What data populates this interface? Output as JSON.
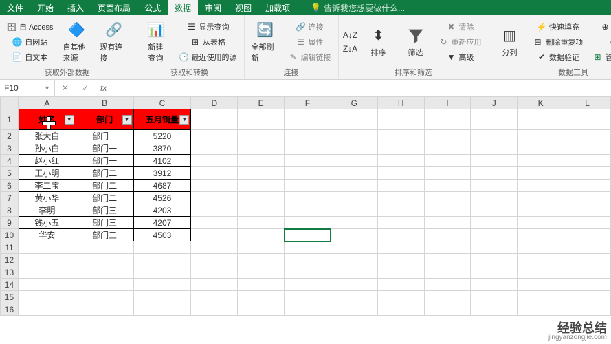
{
  "menu": {
    "tabs": [
      "文件",
      "开始",
      "插入",
      "页面布局",
      "公式",
      "数据",
      "审阅",
      "视图",
      "加载项"
    ],
    "active": 5,
    "tell_me": "告诉我您想要做什么..."
  },
  "ribbon": {
    "groups": {
      "external": {
        "label": "获取外部数据",
        "access": "自 Access",
        "web": "自网站",
        "text": "自文本",
        "other": "自其他来源",
        "existing": "现有连接"
      },
      "transform": {
        "label": "获取和转换",
        "newquery": "新建\n查询",
        "showquery": "显示查询",
        "fromtable": "从表格",
        "recent": "最近使用的源"
      },
      "connections": {
        "label": "连接",
        "refresh": "全部刷新",
        "conn": "连接",
        "prop": "属性",
        "edit": "编辑链接"
      },
      "sortfilter": {
        "label": "排序和筛选",
        "sortaz": "A↓Z",
        "sortza": "Z↓A",
        "sort": "排序",
        "filter": "筛选",
        "clear": "清除",
        "reapply": "重新应用",
        "advanced": "高级"
      },
      "datatools": {
        "label": "数据工具",
        "texttocol": "分列",
        "flashfill": "快速填充",
        "removedup": "删除重复项",
        "validation": "数据验证",
        "consolidate": "合并计算",
        "relations": "关系",
        "datamodel": "管理数据模型"
      }
    }
  },
  "namebox": "F10",
  "formula": "",
  "columns": [
    "A",
    "B",
    "C",
    "D",
    "E",
    "F",
    "G",
    "H",
    "I",
    "J",
    "K",
    "L"
  ],
  "headers": [
    "姓名",
    "部门",
    "五月销量"
  ],
  "rows": [
    {
      "n": "张大白",
      "d": "部门一",
      "v": 5220
    },
    {
      "n": "孙小白",
      "d": "部门一",
      "v": 3870
    },
    {
      "n": "赵小红",
      "d": "部门一",
      "v": 4102
    },
    {
      "n": "王小明",
      "d": "部门二",
      "v": 3912
    },
    {
      "n": "李二宝",
      "d": "部门二",
      "v": 4687
    },
    {
      "n": "黄小华",
      "d": "部门二",
      "v": 4526
    },
    {
      "n": "李明",
      "d": "部门三",
      "v": 4203
    },
    {
      "n": "钱小五",
      "d": "部门三",
      "v": 4207
    },
    {
      "n": "华安",
      "d": "部门三",
      "v": 4503
    }
  ],
  "blank_rows": 6,
  "selected_cell": "F10",
  "watermark": {
    "main": "经验总结",
    "sub": "jingyanzongjie.com"
  }
}
